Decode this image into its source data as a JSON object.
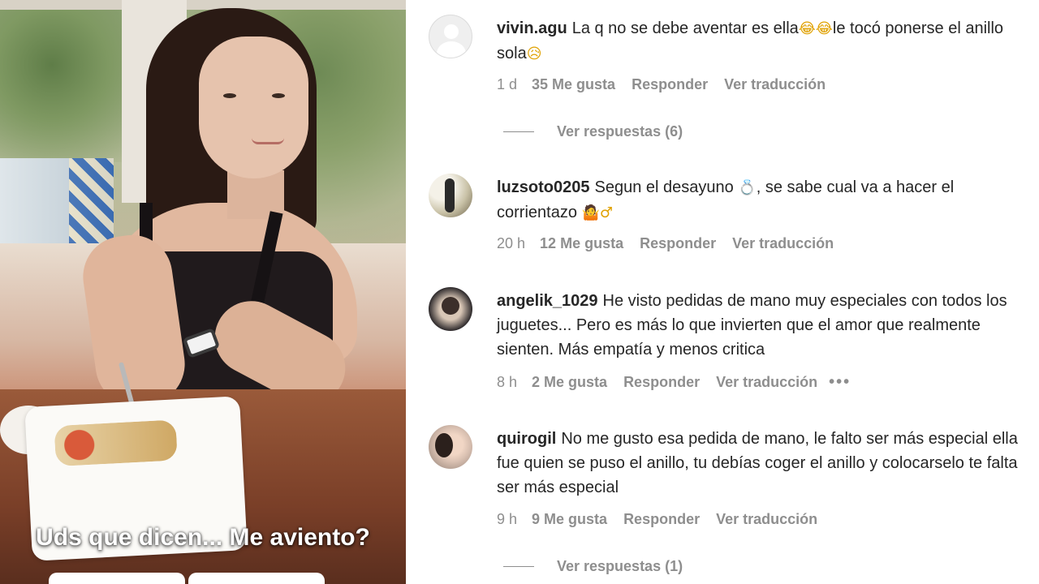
{
  "story": {
    "caption": "Uds que dicen... Me aviento?"
  },
  "comments": [
    {
      "username": "vivin.agu",
      "text_parts": [
        "La q no se debe aventar es ella",
        "le tocó ponerse el anillo sola"
      ],
      "emojis": [
        "😂",
        "😂",
        "😥"
      ],
      "time": "1 d",
      "likes": "35 Me gusta",
      "reply": "Responder",
      "translate": "Ver traducción",
      "view_replies": "Ver respuestas (6)"
    },
    {
      "username": "luzsoto0205",
      "text_parts": [
        "Segun el desayuno",
        ", se sabe cual va a hacer el corrientazo"
      ],
      "emojis": [
        "💍",
        "🤷",
        "♂"
      ],
      "time": "20 h",
      "likes": "12 Me gusta",
      "reply": "Responder",
      "translate": "Ver traducción"
    },
    {
      "username": "angelik_1029",
      "text": "He visto pedidas de mano muy especiales con todos los juguetes... Pero es más lo que invierten que el amor que realmente sienten. Más empatía y menos critica",
      "time": "8 h",
      "likes": "2 Me gusta",
      "reply": "Responder",
      "translate": "Ver traducción",
      "more": "•••"
    },
    {
      "username": "quirogil",
      "text": "No me gusto esa pedida de mano, le falto ser más especial ella fue quien se puso el anillo, tu debías coger el anillo y colocarselo te falta ser más especial",
      "time": "9 h",
      "likes": "9 Me gusta",
      "reply": "Responder",
      "translate": "Ver traducción",
      "view_replies": "Ver respuestas (1)"
    }
  ],
  "icons": {
    "default_avatar": "user-silhouette-icon",
    "more": "ellipsis-icon"
  },
  "colors": {
    "text": "#262626",
    "secondary": "#8e8e8e",
    "background": "#ffffff"
  }
}
